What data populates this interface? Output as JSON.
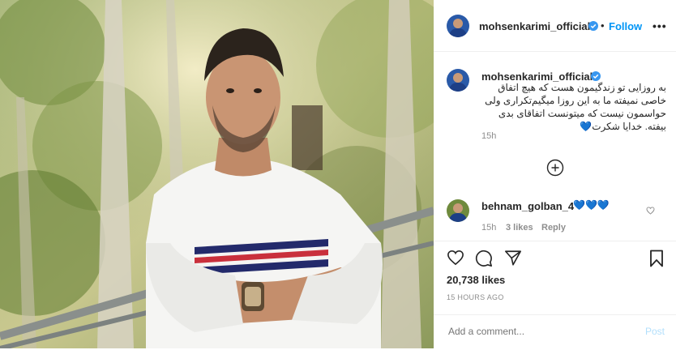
{
  "header": {
    "username": "mohsenkarimi_official",
    "follow_label": "Follow",
    "separator": "•",
    "more_label": "•••"
  },
  "caption": {
    "username": "mohsenkarimi_official",
    "text": "به روزایی تو زندگیمون هست که هیچ اتفاق خاصی نمیفته ما به این روزا میگیم‌تکراری ولی حواسمون نیست که میتونست اتفاقای بدی بیفته. خدایا شکرت💙",
    "time": "15h"
  },
  "comment": {
    "username": "behnam_golban_4",
    "text": "💙💙💙",
    "time": "15h",
    "likes": "3 likes",
    "reply_label": "Reply"
  },
  "post": {
    "likes": "20,738 likes",
    "ago": "15 HOURS AGO"
  },
  "add_comment": {
    "placeholder": "Add a comment...",
    "post_label": "Post"
  },
  "colors": {
    "accent": "#0095f6",
    "verified": "#3897f0",
    "post_disabled": "#b2dffc"
  }
}
